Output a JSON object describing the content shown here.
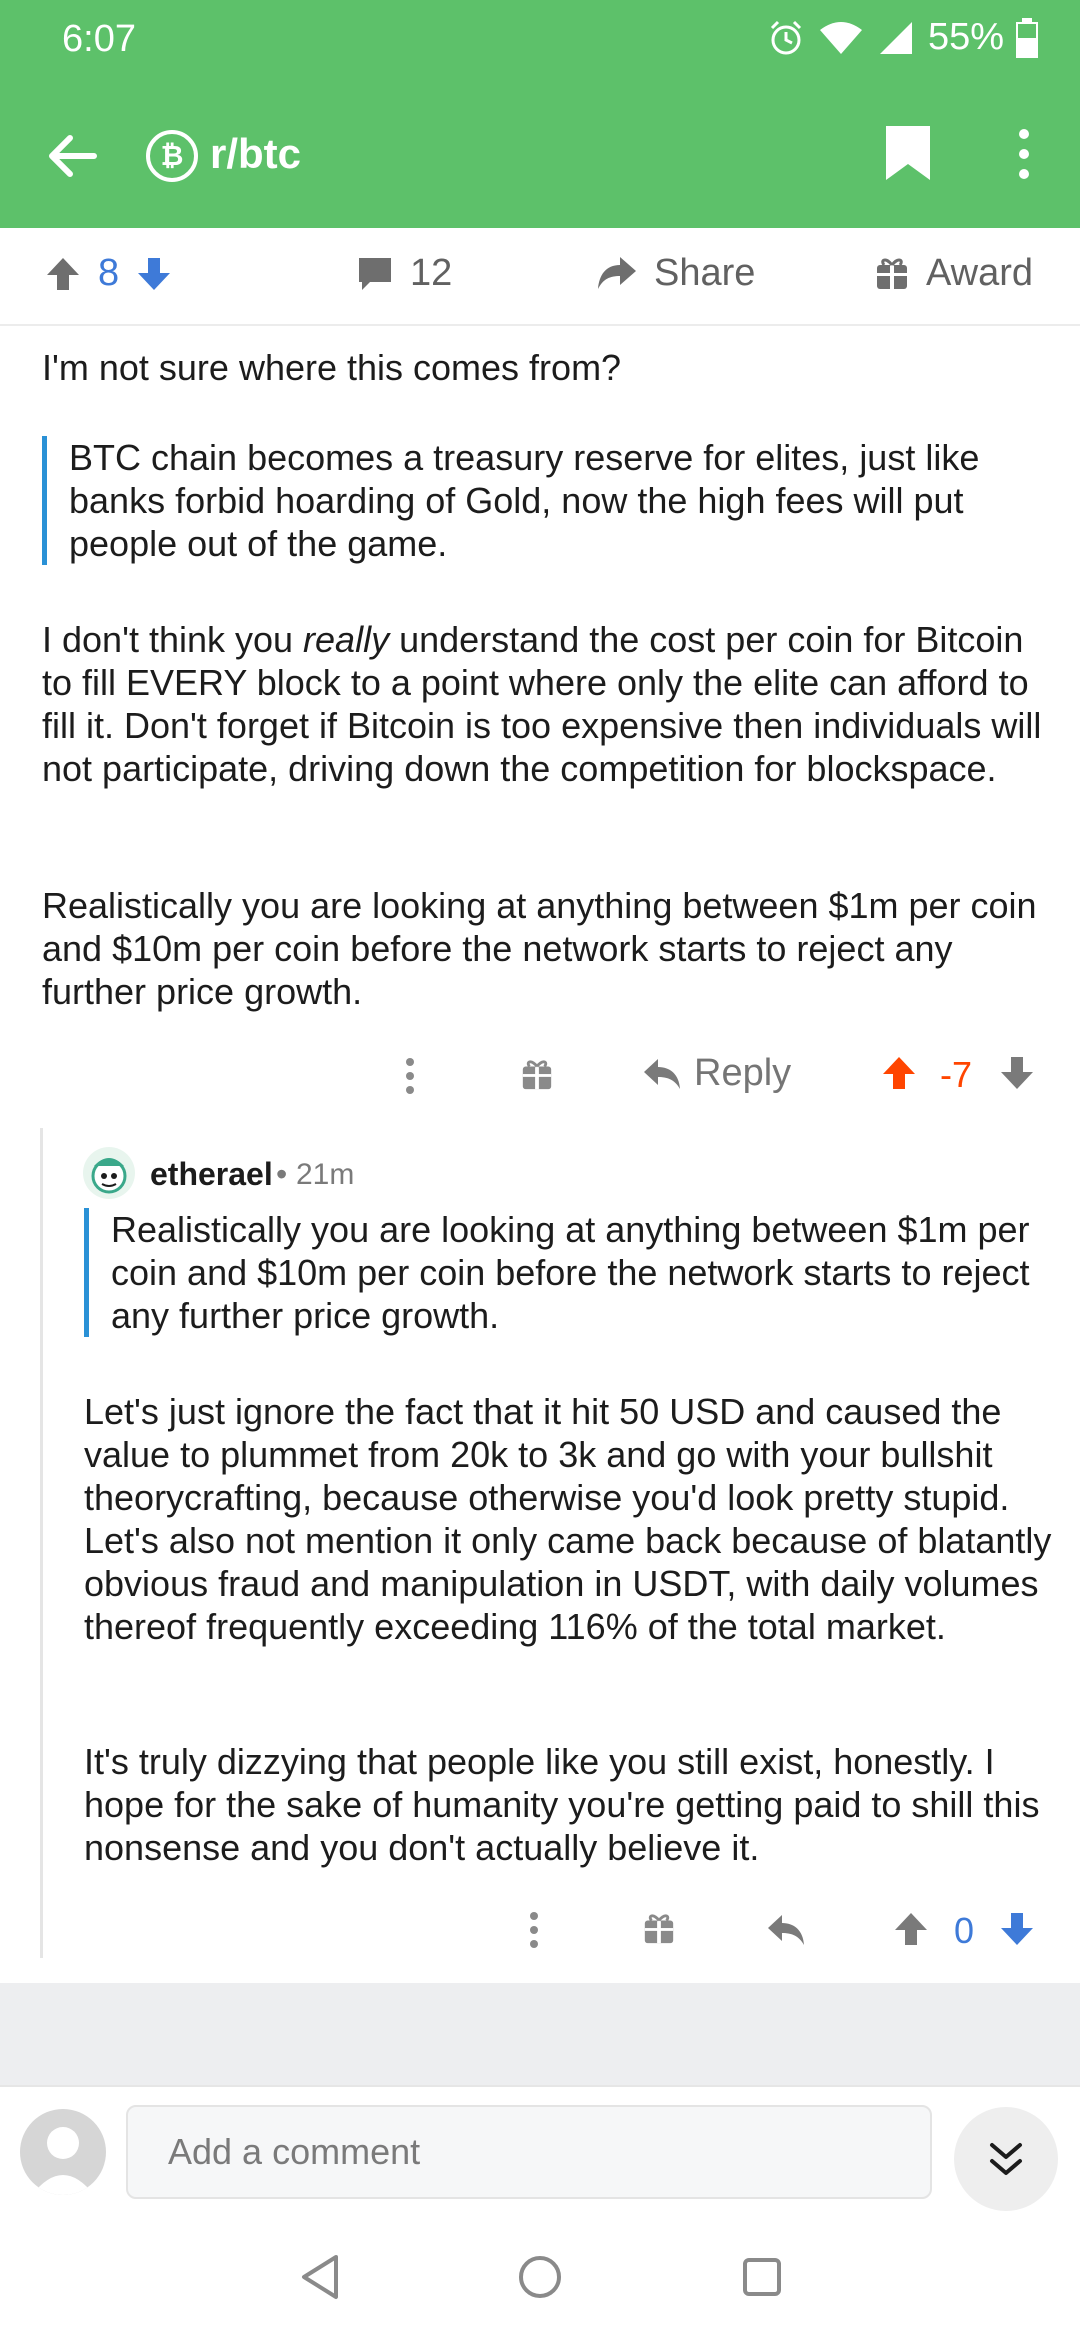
{
  "status": {
    "time": "6:07",
    "battery": "55%"
  },
  "header": {
    "subreddit": "r/btc",
    "subreddit_icon": "₿"
  },
  "post_actions": {
    "score": "8",
    "comments": "12",
    "share": "Share",
    "award": "Award"
  },
  "comment": {
    "intro": "I'm not sure where this comes from?",
    "quote": "BTC chain becomes a treasury reserve for elites, just like banks forbid hoarding of Gold, now the high fees will put people out of the game.",
    "para2_before": "I don't think you ",
    "para2_em": "really",
    "para2_after": " understand the cost per coin for Bitcoin to fill EVERY block to a point where only the elite can afford to fill it. Don't forget if Bitcoin is too expensive then individuals will not participate, driving down the competition for blockspace.",
    "para3": "Realistically you are looking at anything between $1m per coin and $10m per coin before the network starts to reject any further price growth.",
    "reply_label": "Reply",
    "score": "-7"
  },
  "reply": {
    "author": "etherael",
    "age": "21m",
    "quote": "Realistically you are looking at anything between $1m per coin and $10m per coin before the network starts to reject any further price growth.",
    "para1": "Let's just ignore the fact that it hit 50 USD and caused the value to plummet from 20k to 3k and go with your bullshit theorycrafting, because otherwise you'd look pretty stupid. Let's also not mention it only came back because of blatantly obvious fraud and manipulation in USDT, with daily volumes thereof frequently exceeding 116% of the total market.",
    "para2": "It's truly dizzying that people like you still exist, honestly. I hope for the sake of humanity you're getting paid to shill this nonsense and you don't actually believe it.",
    "score": "0"
  },
  "composer": {
    "placeholder": "Add a comment"
  },
  "colors": {
    "brand_green": "#5dc16a",
    "upvote_orange": "#ff4500",
    "downvote_blue": "#3e7ad8",
    "quote_bar": "#2a91d6"
  }
}
